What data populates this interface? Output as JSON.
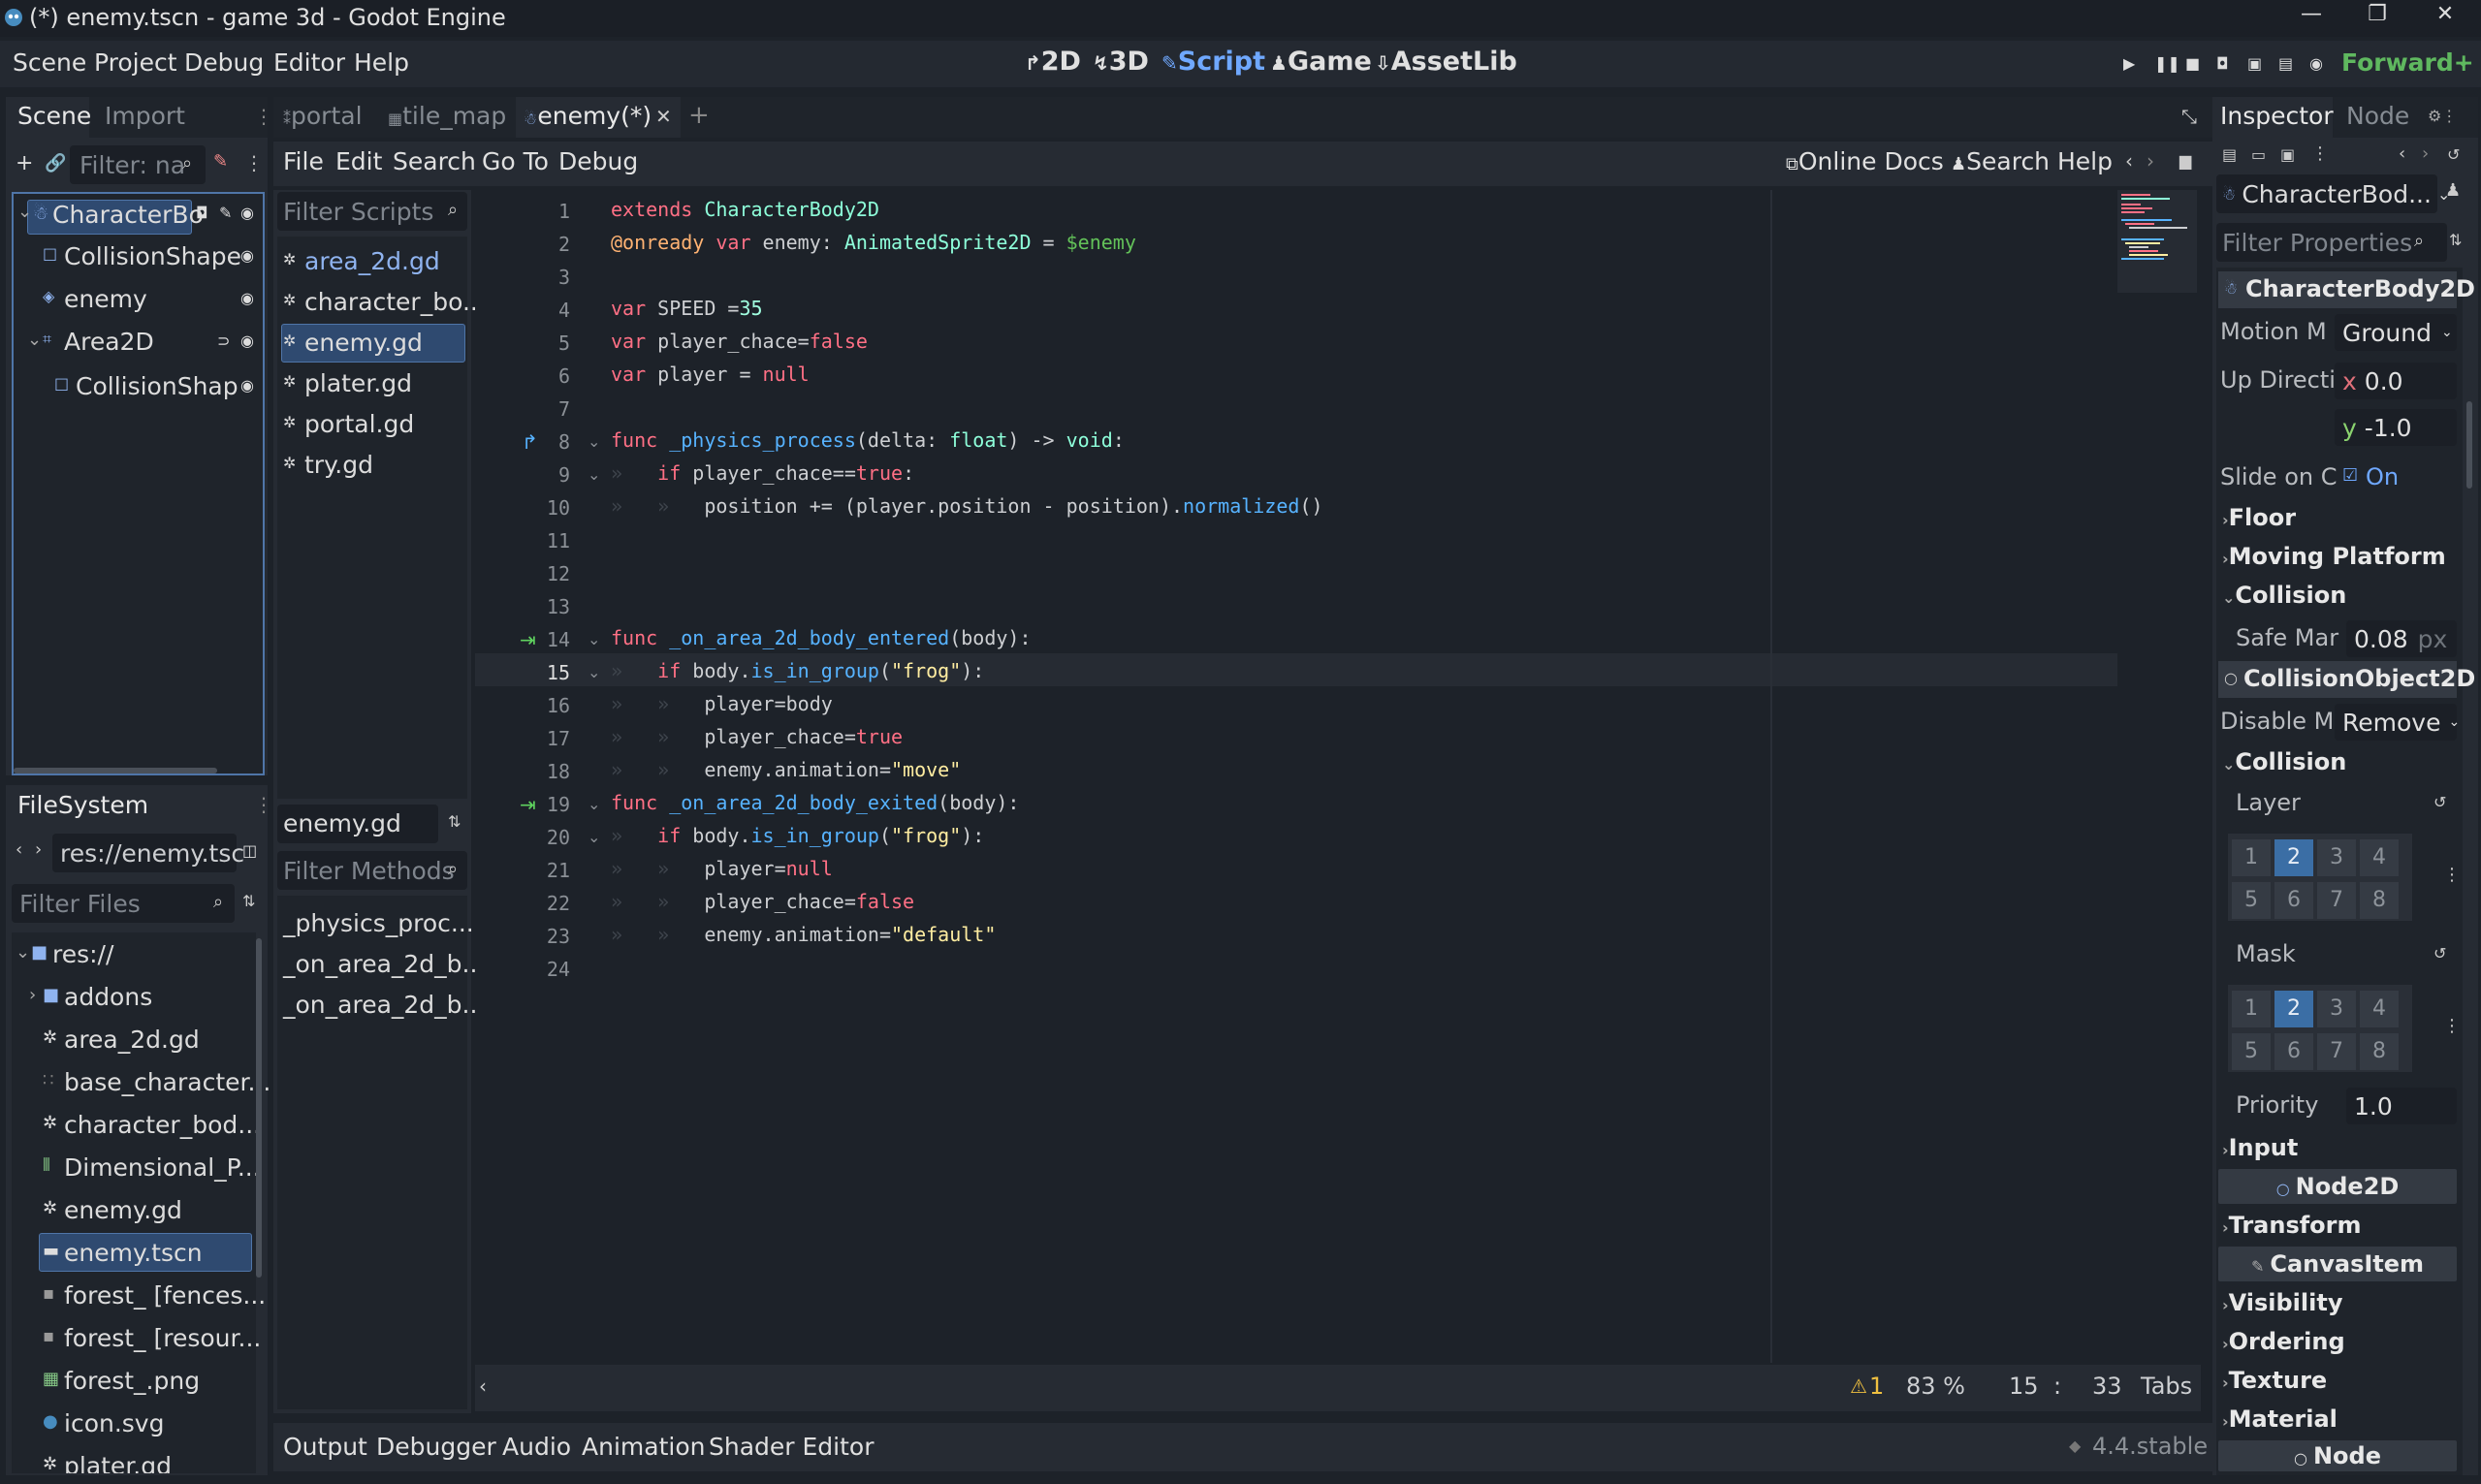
{
  "window": {
    "title": "(*) enemy.tscn - game 3d - Godot Engine",
    "min": "—",
    "max": "❐",
    "close": "✕"
  },
  "menu": {
    "items": [
      "Scene",
      "Project",
      "Debug",
      "Editor",
      "Help"
    ],
    "workspaces": [
      "2D",
      "3D",
      "Script",
      "Game",
      "AssetLib"
    ],
    "renderer": "Forward+"
  },
  "scene_dock": {
    "tabs": [
      "Scene",
      "Import"
    ],
    "filter_placeholder": "Filter: na",
    "nodes": [
      "CharacterBo",
      "CollisionShape",
      "enemy",
      "Area2D",
      "CollisionShap"
    ]
  },
  "filesystem": {
    "title": "FileSystem",
    "path": "res://enemy.tsc",
    "filter_placeholder": "Filter Files",
    "items": [
      "res://",
      "addons",
      "area_2d.gd",
      "base_character...",
      "character_bod...",
      "Dimensional_P...",
      "enemy.gd",
      "enemy.tscn",
      "forest_ [fences...",
      "forest_ [resour...",
      "forest_.png",
      "icon.svg",
      "plater.gd"
    ]
  },
  "scene_tabs": [
    "portal",
    "tile_map",
    "enemy(*)"
  ],
  "script_menu": {
    "items": [
      "File",
      "Edit",
      "Search",
      "Go To",
      "Debug"
    ],
    "online_docs": "Online Docs",
    "search_help": "Search Help"
  },
  "scripts": {
    "filter_placeholder": "Filter Scripts",
    "list": [
      "area_2d.gd",
      "character_bo...",
      "enemy.gd",
      "plater.gd",
      "portal.gd",
      "try.gd"
    ],
    "current": "enemy.gd",
    "methods_placeholder": "Filter Methods",
    "methods": [
      "_physics_proc...",
      "_on_area_2d_b...",
      "_on_area_2d_b..."
    ]
  },
  "editor": {
    "line_numbers": [
      "1",
      "2",
      "3",
      "4",
      "5",
      "6",
      "7",
      "8",
      "9",
      "10",
      "11",
      "12",
      "13",
      "14",
      "15",
      "16",
      "17",
      "18",
      "19",
      "20",
      "21",
      "22",
      "23",
      "24"
    ],
    "status": {
      "warnings": "1",
      "zoom": "83 %",
      "line": "15",
      "sep": ":",
      "col": "33",
      "indent": "Tabs"
    }
  },
  "bottom_panel": {
    "tabs": [
      "Output",
      "Debugger",
      "Audio",
      "Animation",
      "Shader Editor"
    ],
    "version": "4.4.stable"
  },
  "inspector": {
    "tabs": [
      "Inspector",
      "Node"
    ],
    "object": "CharacterBod...",
    "filter_placeholder": "Filter Properties",
    "class_header": "CharacterBody2D",
    "motion_mode_label": "Motion M",
    "motion_mode_value": "Ground",
    "up_direction_label": "Up Directi",
    "up_x_label": "x",
    "up_x": "0.0",
    "up_y_label": "y",
    "up_y": "-1.0",
    "slide_label": "Slide on C",
    "slide_value": "On",
    "floor": "Floor",
    "moving_platform": "Moving Platform",
    "collision_sec": "Collision",
    "safe_margin_label": "Safe Mar",
    "safe_margin_value": "0.08",
    "safe_margin_unit": "px",
    "collision_object": "CollisionObject2D",
    "disable_mode_label": "Disable M",
    "disable_mode_value": "Remove",
    "collision_sec2": "Collision",
    "layer_label": "Layer",
    "mask_label": "Mask",
    "layer_cells": [
      "1",
      "2",
      "3",
      "4",
      "5",
      "6",
      "7",
      "8"
    ],
    "mask_cells": [
      "1",
      "2",
      "3",
      "4",
      "5",
      "6",
      "7",
      "8"
    ],
    "priority_label": "Priority",
    "priority_value": "1.0",
    "input": "Input",
    "node2d": "Node2D",
    "transform": "Transform",
    "canvas_item": "CanvasItem",
    "visibility": "Visibility",
    "ordering": "Ordering",
    "texture": "Texture",
    "material": "Material",
    "node": "Node"
  },
  "colors": {
    "accent": "#6fa8ff",
    "selection": "#2f4a70",
    "background": "#1d2229"
  }
}
